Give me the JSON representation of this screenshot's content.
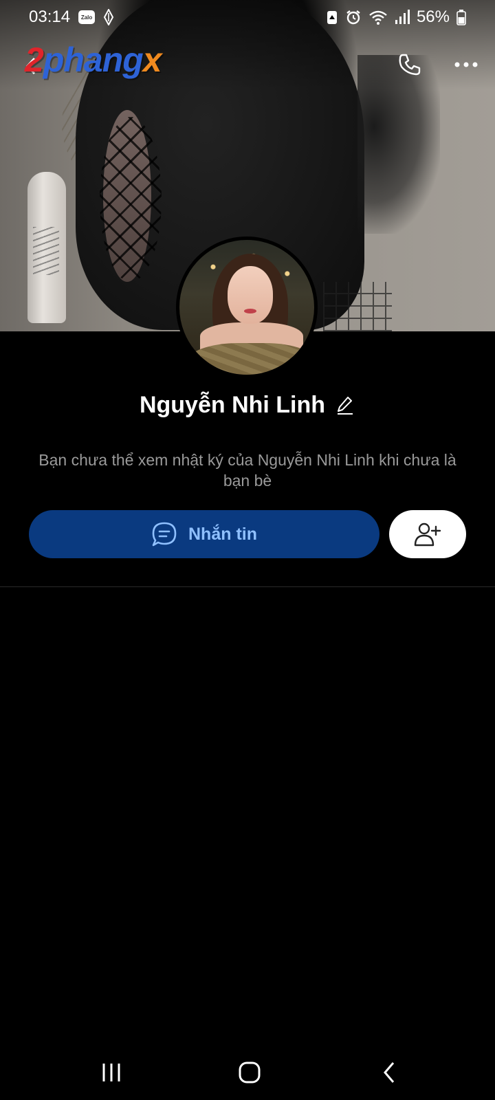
{
  "status_bar": {
    "time": "03:14",
    "zalo_badge": "Zalo",
    "battery": "56%"
  },
  "top_bar": {
    "logo": {
      "part1": "2",
      "part2": "phang",
      "part3": "x"
    }
  },
  "profile": {
    "name": "Nguyễn Nhi Linh",
    "notice": "Bạn chưa thể xem nhật ký của Nguyễn Nhi Linh khi chưa là bạn bè"
  },
  "actions": {
    "message_label": "Nhắn tin"
  },
  "colors": {
    "message_button": "#0a3a80",
    "message_text": "#8fc0ff",
    "background": "#000000",
    "notice_text": "#9a9a9a"
  },
  "icons": {
    "back": "chevron-left-icon",
    "call": "phone-icon",
    "more": "more-horizontal-icon",
    "edit": "pencil-icon",
    "message": "chat-bubble-icon",
    "add_friend": "add-user-icon"
  }
}
